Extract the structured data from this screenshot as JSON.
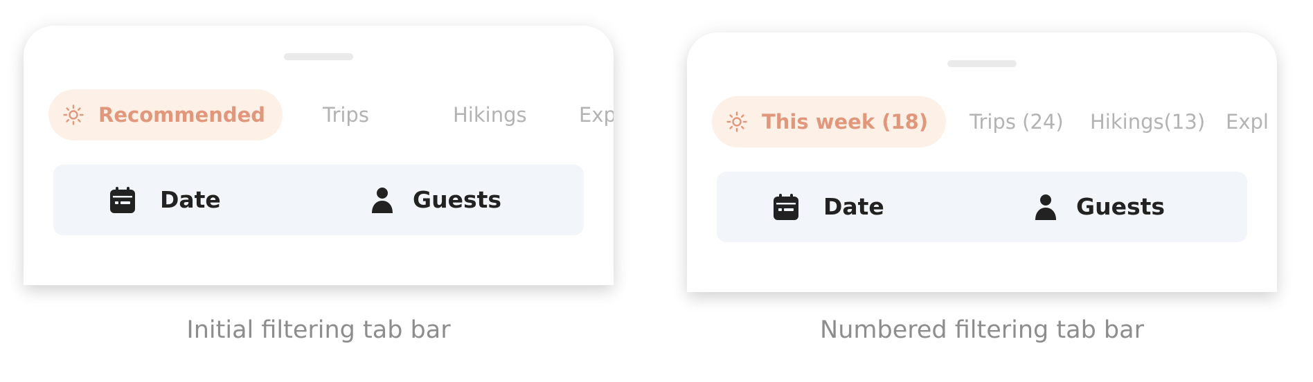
{
  "colors": {
    "accent_text": "#e1977b",
    "accent_pill": "#fdf1e7",
    "inactive_tab": "#b3b3b3",
    "search_bar_bg": "#f2f5f9",
    "caption_text": "#8d8d8d"
  },
  "initial": {
    "tabs": [
      {
        "label": "Recommended",
        "icon": "sun-icon",
        "active": true
      },
      {
        "label": "Trips",
        "active": false
      },
      {
        "label": "Hikings",
        "active": false
      },
      {
        "label": "Explo",
        "active": false
      }
    ],
    "search": {
      "date_label": "Date",
      "date_icon": "calendar-icon",
      "guests_label": "Guests",
      "guests_icon": "person-icon"
    },
    "caption": "Initial filtering tab bar"
  },
  "numbered": {
    "tabs": [
      {
        "label": "This week (18)",
        "icon": "sun-icon",
        "active": true
      },
      {
        "label": "Trips (24)",
        "active": false
      },
      {
        "label": "Hikings(13)",
        "active": false
      },
      {
        "label": "Expl",
        "active": false
      }
    ],
    "search": {
      "date_label": "Date",
      "date_icon": "calendar-icon",
      "guests_label": "Guests",
      "guests_icon": "person-icon"
    },
    "caption": "Numbered filtering tab bar"
  }
}
